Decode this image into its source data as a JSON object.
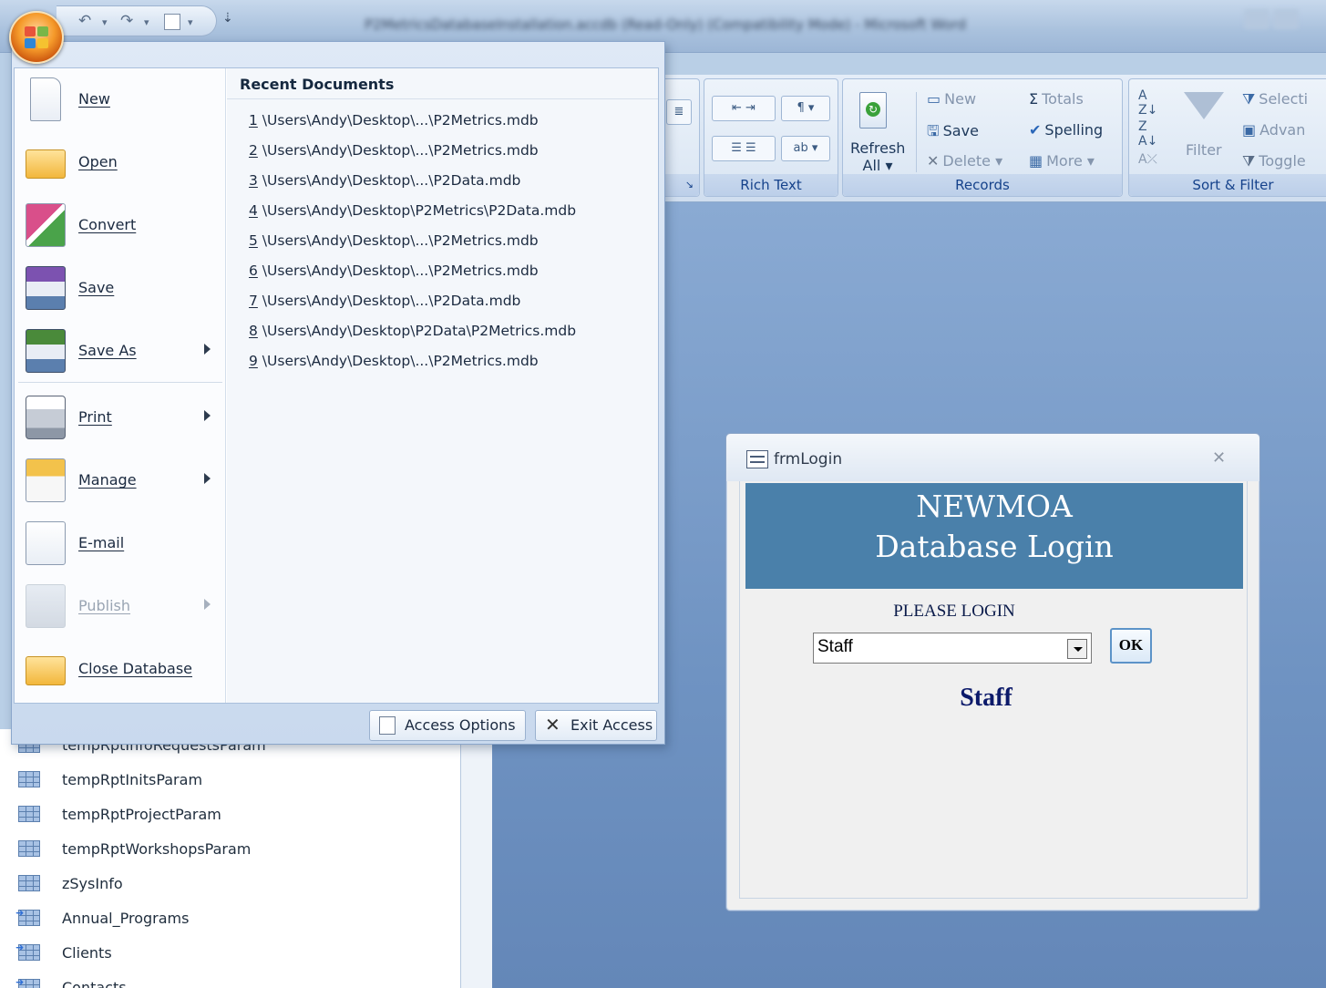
{
  "window": {
    "title": "P2MetricsDatabaseInstallation.accdb (Read-Only) (Compatibility Mode) - Microsoft Word"
  },
  "quick_access": {
    "undo_icon": "undo-icon",
    "redo_icon": "redo-icon",
    "customize_icon": "dropdown-icon"
  },
  "office_menu": {
    "left_items": [
      {
        "label": "New",
        "icon": "new-document-icon",
        "has_submenu": false,
        "disabled": false
      },
      {
        "label": "Open",
        "icon": "open-folder-icon",
        "has_submenu": false,
        "disabled": false
      },
      {
        "label": "Convert",
        "icon": "convert-icon",
        "has_submenu": false,
        "disabled": false
      },
      {
        "label": "Save",
        "icon": "save-disk-icon",
        "has_submenu": false,
        "disabled": false
      },
      {
        "label": "Save As",
        "icon": "save-as-icon",
        "has_submenu": true,
        "disabled": false
      },
      {
        "label": "Print",
        "icon": "printer-icon",
        "has_submenu": true,
        "disabled": false
      },
      {
        "label": "Manage",
        "icon": "manage-icon",
        "has_submenu": true,
        "disabled": false
      },
      {
        "label": "E-mail",
        "icon": "email-icon",
        "has_submenu": false,
        "disabled": false
      },
      {
        "label": "Publish",
        "icon": "publish-icon",
        "has_submenu": true,
        "disabled": true
      },
      {
        "label": "Close Database",
        "icon": "close-folder-icon",
        "has_submenu": false,
        "disabled": false
      }
    ],
    "recent_header": "Recent Documents",
    "recent_documents": [
      {
        "num": "1",
        "path": " \\Users\\Andy\\Desktop\\...\\P2Metrics.mdb"
      },
      {
        "num": "2",
        "path": " \\Users\\Andy\\Desktop\\...\\P2Metrics.mdb"
      },
      {
        "num": "3",
        "path": " \\Users\\Andy\\Desktop\\...\\P2Data.mdb"
      },
      {
        "num": "4",
        "path": " \\Users\\Andy\\Desktop\\P2Metrics\\P2Data.mdb"
      },
      {
        "num": "5",
        "path": " \\Users\\Andy\\Desktop\\...\\P2Metrics.mdb"
      },
      {
        "num": "6",
        "path": " \\Users\\Andy\\Desktop\\...\\P2Metrics.mdb"
      },
      {
        "num": "7",
        "path": " \\Users\\Andy\\Desktop\\...\\P2Data.mdb"
      },
      {
        "num": "8",
        "path": " \\Users\\Andy\\Desktop\\P2Data\\P2Metrics.mdb"
      },
      {
        "num": "9",
        "path": " \\Users\\Andy\\Desktop\\...\\P2Metrics.mdb"
      }
    ],
    "access_options_label": "Access Options",
    "exit_access_label": "Exit Access"
  },
  "ribbon": {
    "rich_text": {
      "label": "Rich Text"
    },
    "records": {
      "label": "Records",
      "refresh_line1": "Refresh",
      "refresh_line2": "All",
      "new": "New",
      "save": "Save",
      "delete": "Delete",
      "totals": "Totals",
      "spelling": "Spelling",
      "more": "More"
    },
    "sort_filter": {
      "label": "Sort & Filter",
      "filter": "Filter",
      "selection": "Selecti",
      "advanced": "Advan",
      "toggle": "Toggle"
    }
  },
  "nav_pane": {
    "items": [
      {
        "label": "tempRptInfoRequestsParam",
        "linked": false
      },
      {
        "label": "tempRptInitsParam",
        "linked": false
      },
      {
        "label": "tempRptProjectParam",
        "linked": false
      },
      {
        "label": "tempRptWorkshopsParam",
        "linked": false
      },
      {
        "label": "zSysInfo",
        "linked": false
      },
      {
        "label": "Annual_Programs",
        "linked": true
      },
      {
        "label": "Clients",
        "linked": true
      },
      {
        "label": "Contacts",
        "linked": true
      }
    ]
  },
  "login_form": {
    "title": "frmLogin",
    "banner_line1": "NEWMOA",
    "banner_line2": "Database Login",
    "prompt": "PLEASE LOGIN",
    "combo_value": "Staff",
    "ok_label": "OK",
    "selected_display": "Staff",
    "banner_color": "#4a80aa"
  },
  "colors": {
    "workspace": "#6f93c2",
    "ribbon_label": "#15428b",
    "accent_orange": "#f59a2a"
  }
}
